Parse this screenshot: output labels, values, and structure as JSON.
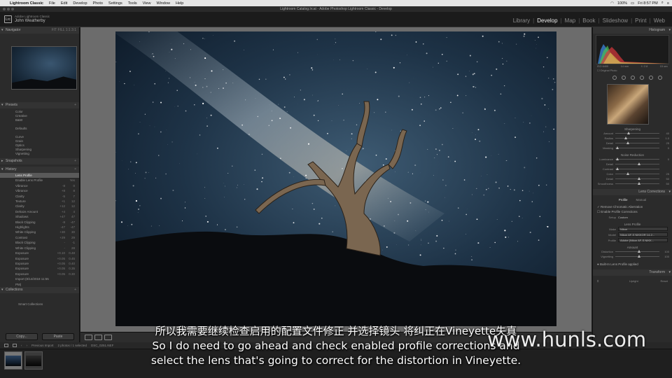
{
  "mac_menubar": {
    "app": "Lightroom Classic",
    "items": [
      "File",
      "Edit",
      "Develop",
      "Photo",
      "Settings",
      "Tools",
      "View",
      "Window",
      "Help"
    ],
    "battery": "100%",
    "clock": "Fri 8:57 PM"
  },
  "window_title": "Lightroom Catalog.lrcat - Adobe Photoshop Lightroom Classic - Develop",
  "identity": {
    "app_label": "Adobe Lightroom Classic",
    "user": "John Weatherby",
    "logo": "Lrc"
  },
  "modules": [
    "Library",
    "Develop",
    "Map",
    "Book",
    "Slideshow",
    "Print",
    "Web"
  ],
  "active_module": "Develop",
  "left_panel": {
    "navigator": {
      "title": "Navigator",
      "zoom": "FIT  FILL  1:1  3:1"
    },
    "presets": {
      "title": "Presets",
      "items": [
        "Color",
        "Creative",
        "B&W",
        "",
        "Defaults",
        "",
        "Curve",
        "Grain",
        "Optics",
        "Sharpening",
        "Vignetting"
      ]
    },
    "snapshots": {
      "title": "Snapshots"
    },
    "history": {
      "title": "History",
      "rows": [
        {
          "n": "Lens Profile",
          "a": "",
          "v": ""
        },
        {
          "n": "Enable Lens Profile",
          "a": "",
          "v": "Yes"
        },
        {
          "n": "Vibrance",
          "a": "-8",
          "v": "0"
        },
        {
          "n": "Vibrance",
          "a": "+8",
          "v": "8"
        },
        {
          "n": "Clarity",
          "a": "-5",
          "v": "7"
        },
        {
          "n": "Texture",
          "a": "+1",
          "v": "12"
        },
        {
          "n": "Clarity",
          "a": "+12",
          "v": "12"
        },
        {
          "n": "Dehaze Amount",
          "a": "+4",
          "v": "4"
        },
        {
          "n": "Shadows",
          "a": "+47",
          "v": "47"
        },
        {
          "n": "Black Clipping",
          "a": "-8",
          "v": "-47"
        },
        {
          "n": "Highlights",
          "a": "-47",
          "v": "-47"
        },
        {
          "n": "White Clipping",
          "a": "+30",
          "v": "30"
        },
        {
          "n": "Contrast",
          "a": "+29",
          "v": "29"
        },
        {
          "n": "Black Clipping",
          "a": "-",
          "v": "-1"
        },
        {
          "n": "White Clipping",
          "a": "-",
          "v": "28"
        },
        {
          "n": "Exposure",
          "a": "+0.10",
          "v": "0.48"
        },
        {
          "n": "Exposure",
          "a": "+0.05",
          "v": "0.45"
        },
        {
          "n": "Exposure",
          "a": "+0.05",
          "v": "0.40"
        },
        {
          "n": "Exposure",
          "a": "+0.05",
          "v": "0.35"
        },
        {
          "n": "Exposure",
          "a": "+0.05",
          "v": "0.30"
        },
        {
          "n": "Import (8/14/2018 11:55 PM)",
          "a": "",
          "v": ""
        }
      ]
    },
    "collections": {
      "title": "Collections",
      "items": [
        "Smart Collections"
      ]
    },
    "copy_label": "Copy...",
    "paste_label": "Paste"
  },
  "right_panel": {
    "histogram": {
      "title": "Histogram",
      "iso": "ISO 6400",
      "focal": "14 mm",
      "aperture": "f / 2.8",
      "shutter": "15 sec",
      "original_photo": "Original Photo"
    },
    "detail": {
      "sharpening_title": "Sharpening",
      "sharpening": [
        {
          "label": "Amount",
          "value": "40",
          "pos": 0.27
        },
        {
          "label": "Radius",
          "value": "1.0",
          "pos": 0.2
        },
        {
          "label": "Detail",
          "value": "25",
          "pos": 0.25
        },
        {
          "label": "Masking",
          "value": "0",
          "pos": 0.02
        }
      ],
      "noise_title": "Noise Reduction",
      "noise": [
        {
          "label": "Luminance",
          "value": "0",
          "pos": 0.02
        },
        {
          "label": "Detail",
          "value": "",
          "pos": 0.5
        },
        {
          "label": "Contrast",
          "value": "",
          "pos": 0.02
        },
        {
          "label": "Color",
          "value": "25",
          "pos": 0.25
        },
        {
          "label": "Detail",
          "value": "50",
          "pos": 0.5
        },
        {
          "label": "Smoothness",
          "value": "50",
          "pos": 0.5
        }
      ]
    },
    "lens": {
      "title": "Lens Corrections",
      "tabs": [
        "Profile",
        "Manual"
      ],
      "remove_ca": "Remove Chromatic Aberration",
      "enable_profile": "Enable Profile Corrections",
      "setup_label": "Setup",
      "setup_value": "Custom",
      "lens_profile_title": "Lens Profile",
      "make_label": "Make",
      "make_value": "Nikon",
      "model_label": "Model",
      "model_value": "Nikon AF-S NIKKOR 14-2...",
      "profile_label": "Profile",
      "profile_value": "Adobe (Nikon AF-S NIKK...",
      "amount_title": "Amount",
      "amount": [
        {
          "label": "Distortion",
          "value": "100",
          "pos": 0.5
        },
        {
          "label": "Vignetting",
          "value": "100",
          "pos": 0.5
        }
      ],
      "builtin": "Built-In Lens Profile applied"
    },
    "transform": {
      "title": "Transform",
      "upright": "Upright",
      "reset": "Reset"
    }
  },
  "toolbar": {
    "soft_proofing": "Soft Proofing"
  },
  "filmstrip": {
    "nav": "Previous Import",
    "info": "2 photos / 1 selected",
    "filename": "DSC_0251.NEF"
  },
  "subtitles": {
    "cn": "所以我需要继续检查启用的配置文件修正 并选择镜头 将纠正在Vineyette失真",
    "en1": "So I do need to go ahead and check enabled profile corrections and",
    "en2": "select the lens that's going to correct for the distortion in Vineyette."
  },
  "watermark": "www.hunls.com"
}
